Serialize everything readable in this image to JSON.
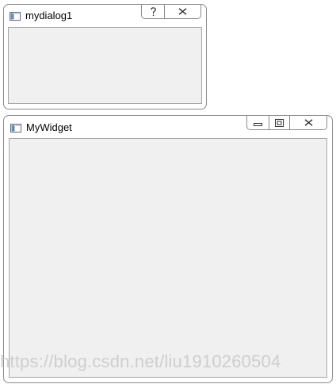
{
  "dialog": {
    "title": "mydialog1",
    "buttons": {
      "help_icon": "question-mark-icon",
      "close_icon": "close-icon"
    }
  },
  "widget": {
    "title": "MyWidget",
    "buttons": {
      "minimize_icon": "minimize-icon",
      "maximize_icon": "maximize-icon",
      "close_icon": "close-icon"
    }
  },
  "watermark": {
    "text": "https://blog.csdn.net/liu1910260504"
  },
  "colors": {
    "window_border": "#8a8a8a",
    "client_background": "#f0f0f0",
    "client_border": "#a5a5a5",
    "icon_stroke": "#333333",
    "watermark": "#c8c8c8"
  }
}
